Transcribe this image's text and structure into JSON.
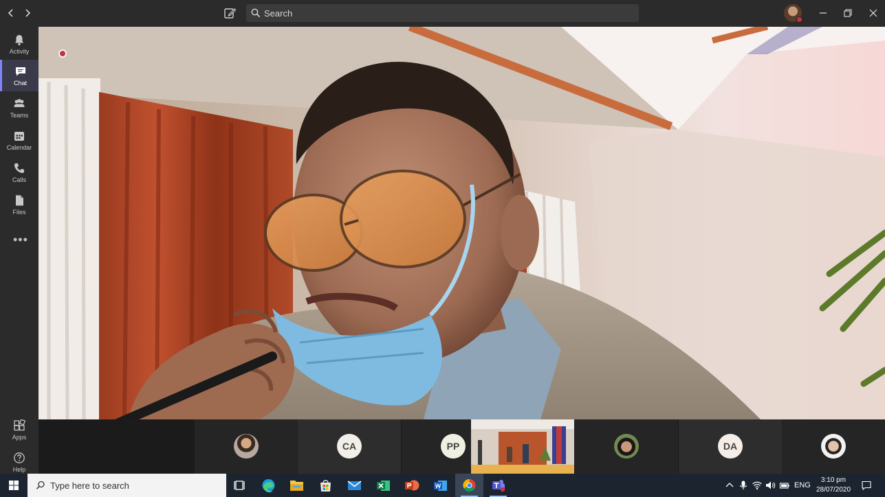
{
  "titlebar": {
    "search_placeholder": "Search",
    "icons": [
      "back-arrow-icon",
      "forward-arrow-icon",
      "compose-icon",
      "search-icon",
      "minimize-icon",
      "restore-icon",
      "close-icon"
    ]
  },
  "rail": {
    "items": [
      {
        "label": "Activity",
        "icon": "bell-icon"
      },
      {
        "label": "Chat",
        "icon": "chat-icon",
        "active": true
      },
      {
        "label": "Teams",
        "icon": "teams-icon"
      },
      {
        "label": "Calendar",
        "icon": "calendar-icon"
      },
      {
        "label": "Calls",
        "icon": "phone-icon"
      },
      {
        "label": "Files",
        "icon": "file-icon"
      },
      {
        "label": "Apps",
        "icon": "apps-icon"
      },
      {
        "label": "Help",
        "icon": "help-icon"
      }
    ],
    "more_label": "•••"
  },
  "stage": {
    "recording": true,
    "accent_color": "#c4314b"
  },
  "participants": [
    {
      "type": "photo",
      "initials": ""
    },
    {
      "type": "initials",
      "initials": "CA"
    },
    {
      "type": "initials",
      "initials": "PP"
    },
    {
      "type": "video",
      "initials": ""
    },
    {
      "type": "photo",
      "initials": ""
    },
    {
      "type": "initials",
      "initials": "DA"
    },
    {
      "type": "photo",
      "initials": ""
    }
  ],
  "taskbar": {
    "search_placeholder": "Type here to search",
    "apps": [
      "task-view-icon",
      "edge-icon",
      "file-explorer-icon",
      "store-icon",
      "mail-icon",
      "excel-icon",
      "powerpoint-icon",
      "word-icon",
      "chrome-icon",
      "teams-app-icon"
    ],
    "tray": {
      "language": "ENG",
      "time": "3:10 pm",
      "date": "28/07/2020"
    }
  },
  "colors": {
    "teams_purple": "#6264a7",
    "rail_accent": "#7f85f5",
    "status_red": "#c4314b"
  }
}
